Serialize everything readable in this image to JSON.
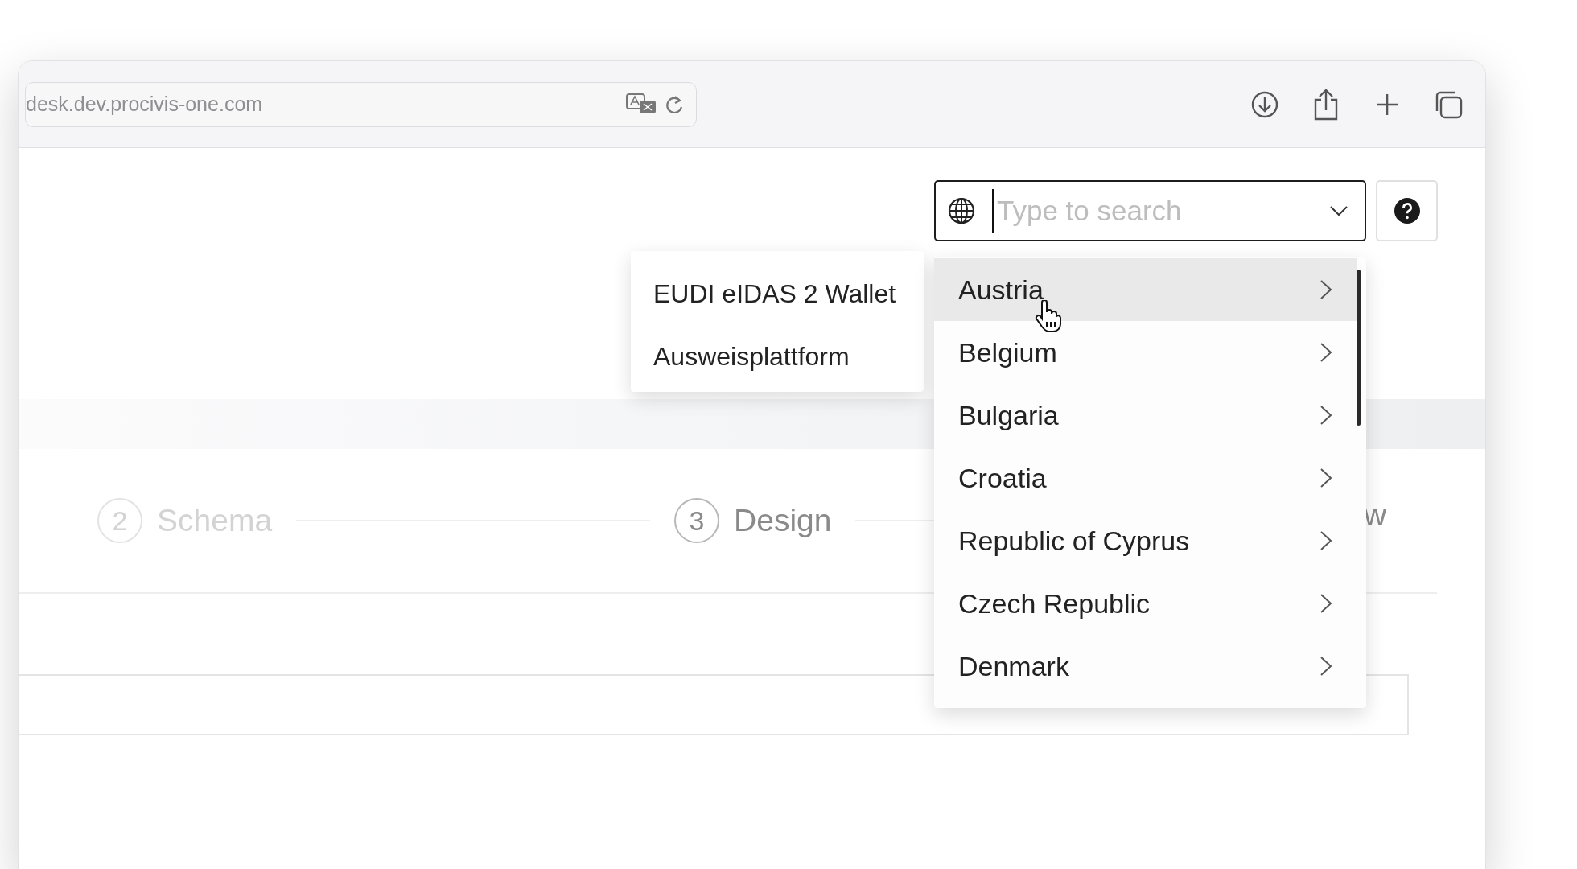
{
  "browser": {
    "address": "desk.dev.procivis-one.com"
  },
  "search": {
    "placeholder": "Type to search"
  },
  "steps": [
    {
      "number": "2",
      "label": "Schema",
      "selected": false
    },
    {
      "number": "3",
      "label": "Design",
      "selected": true
    }
  ],
  "step_partial": "w",
  "countries": [
    {
      "label": "Austria",
      "selected": true
    },
    {
      "label": "Belgium",
      "selected": false
    },
    {
      "label": "Bulgaria",
      "selected": false
    },
    {
      "label": "Croatia",
      "selected": false
    },
    {
      "label": "Republic of Cyprus",
      "selected": false
    },
    {
      "label": "Czech Republic",
      "selected": false
    },
    {
      "label": "Denmark",
      "selected": false
    }
  ],
  "submenu": [
    "EUDI eIDAS 2 Wallet",
    "Ausweisplattform"
  ]
}
